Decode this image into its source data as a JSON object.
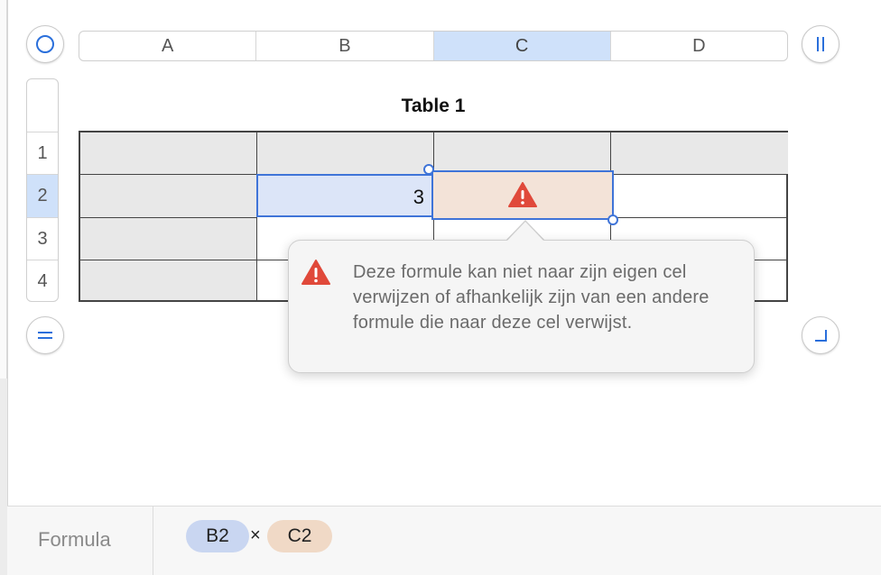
{
  "columns": [
    {
      "label": "A",
      "selected": false
    },
    {
      "label": "B",
      "selected": false
    },
    {
      "label": "C",
      "selected": true
    },
    {
      "label": "D",
      "selected": false
    }
  ],
  "rows": [
    {
      "label": "1",
      "selected": false
    },
    {
      "label": "2",
      "selected": true
    },
    {
      "label": "3",
      "selected": false
    },
    {
      "label": "4",
      "selected": false
    }
  ],
  "table": {
    "title": "Table 1",
    "cell_b2_value": "3"
  },
  "error_popover": {
    "icon": "warning-icon",
    "message": "Deze formule kan niet naar zijn eigen cel verwijzen of afhankelijk zijn van een andere formule die naar deze cel verwijst."
  },
  "formula_bar": {
    "label": "Formula",
    "token_1": "B2",
    "operator": "×",
    "token_2": "C2"
  },
  "colors": {
    "accent": "#3f74d8",
    "selection": "#cfe1fa",
    "error_cell": "#f3e3d8",
    "warning": "#e0493a"
  }
}
